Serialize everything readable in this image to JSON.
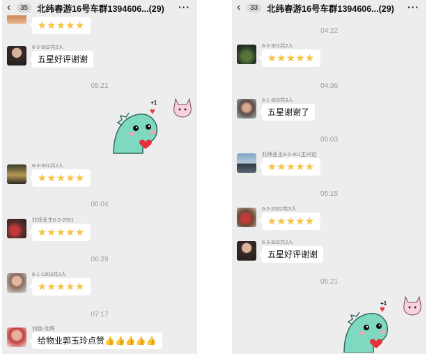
{
  "left": {
    "back_icon": "‹",
    "badge": "35",
    "title": "北纬春游16号车群1394606...(29)",
    "more": "···",
    "items": [
      {
        "kind": "msg",
        "sender": "",
        "text": "☆☆☆☆☆"
      },
      {
        "kind": "msg",
        "sender": "6-3-502共2人",
        "text": "五星好评谢谢"
      },
      {
        "kind": "time",
        "text": "05:21"
      },
      {
        "kind": "msg",
        "sender": "6-3-501共2人",
        "text": "☆☆☆☆☆"
      },
      {
        "kind": "time",
        "text": "06:04"
      },
      {
        "kind": "msg",
        "sender": "北纬业主6-2-2501",
        "text": "☆☆☆☆☆"
      },
      {
        "kind": "time",
        "text": "06:29"
      },
      {
        "kind": "msg",
        "sender": "6-1-1803共3人",
        "text": "☆☆☆☆☆"
      },
      {
        "kind": "time",
        "text": "07:17"
      },
      {
        "kind": "msg",
        "sender": "刘燚-北纬",
        "text": "给物业郭玉玲点赞👍👍👍👍👍"
      }
    ],
    "sticker_plus": "+1"
  },
  "right": {
    "back_icon": "‹",
    "badge": "33",
    "title": "北纬春游16号车群1394606...(29)",
    "more": "···",
    "items": [
      {
        "kind": "time",
        "text": "04:22"
      },
      {
        "kind": "msg",
        "sender": "6-2-301共2人",
        "text": "☆☆☆☆☆"
      },
      {
        "kind": "time",
        "text": "04:36"
      },
      {
        "kind": "msg",
        "sender": "6-1-803共3人",
        "text": "五星谢谢了"
      },
      {
        "kind": "time",
        "text": "05:03"
      },
      {
        "kind": "msg",
        "sender": "北纬业主6-2-401王兴远",
        "text": "☆☆☆☆☆"
      },
      {
        "kind": "time",
        "text": "05:15"
      },
      {
        "kind": "msg",
        "sender": "6-2-2002共3人",
        "text": "☆☆☆☆☆"
      },
      {
        "kind": "msg",
        "sender": "6-3-502共2人",
        "text": "五星好评谢谢"
      },
      {
        "kind": "time",
        "text": "05:21"
      }
    ],
    "sticker_plus": "+1"
  },
  "colors": {
    "star": "#f6c342",
    "bg": "#ededed",
    "bubble": "#ffffff",
    "dino": "#7fd8c0"
  },
  "icons": {
    "back": "chevron-left-icon",
    "more": "more-dots-icon",
    "star": "star-icon",
    "heart": "heart-icon"
  }
}
